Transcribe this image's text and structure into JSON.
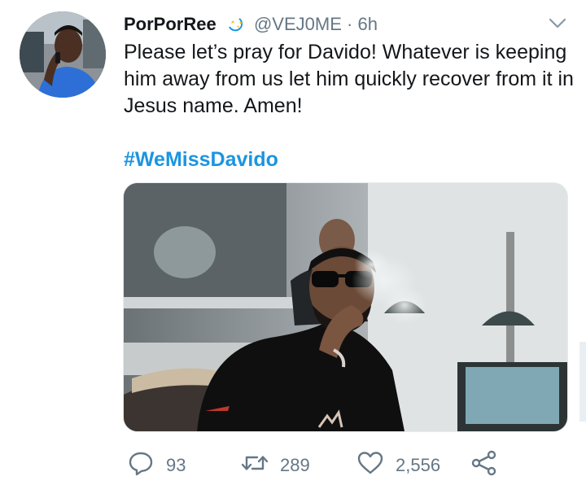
{
  "tweet": {
    "display_name": "PorPorRee",
    "handle": "@VEJ0ME",
    "separator": "·",
    "time": "6h",
    "text": "Please let’s pray for Davido! Whatever is keeping him away from us let him quickly recover from it in Jesus name. Amen!",
    "hashtag": "#WeMissDavido"
  },
  "actions": {
    "replies": "93",
    "retweets": "289",
    "likes": "2,556"
  },
  "colors": {
    "accent": "#1b95e0",
    "muted": "#657786",
    "text": "#14171a"
  },
  "icons": [
    "emoji-badge-icon",
    "chevron-down-icon",
    "reply-icon",
    "retweet-icon",
    "like-icon",
    "share-icon"
  ]
}
